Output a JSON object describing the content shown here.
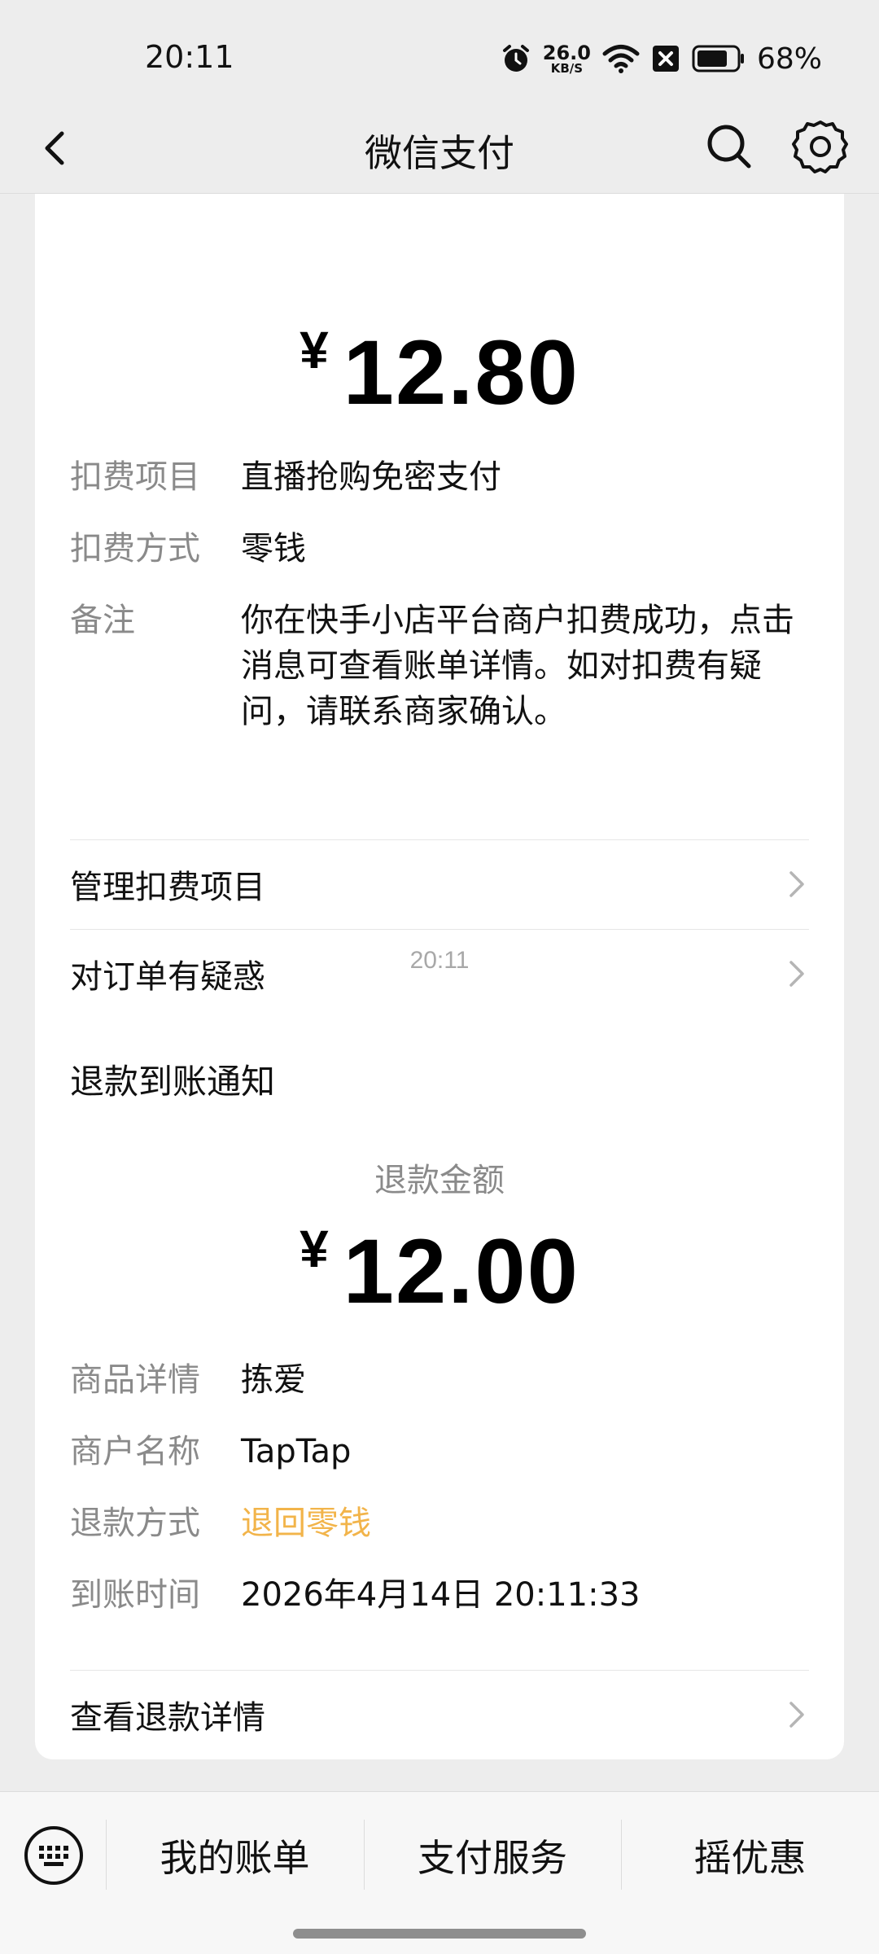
{
  "status_bar": {
    "time": "20:11",
    "net_speed_value": "26.0",
    "net_speed_unit": "KB/S",
    "battery_percent": "68%"
  },
  "nav": {
    "title": "微信支付"
  },
  "card1": {
    "amount_symbol": "¥",
    "amount_value": "12.80",
    "rows": [
      {
        "key": "扣费项目",
        "value": "直播抢购免密支付"
      },
      {
        "key": "扣费方式",
        "value": "零钱"
      },
      {
        "key": "备注",
        "value": "你在快手小店平台商户扣费成功，点击消息可查看账单详情。如对扣费有疑问，请联系商家确认。"
      }
    ],
    "links": [
      {
        "label": "管理扣费项目"
      },
      {
        "label": "对订单有疑惑"
      }
    ]
  },
  "timestamp": "20:11",
  "card2": {
    "title": "退款到账通知",
    "subtitle": "退款金额",
    "amount_symbol": "¥",
    "amount_value": "12.00",
    "rows": [
      {
        "key": "商品详情",
        "value": "拣爱"
      },
      {
        "key": "商户名称",
        "value": "TapTap"
      },
      {
        "key": "退款方式",
        "value": "退回零钱"
      },
      {
        "key": "到账时间",
        "value": "2026年4月14日 20:11:33"
      }
    ],
    "link": {
      "label": "查看退款详情"
    }
  },
  "bottom_menu": {
    "items": [
      "我的账单",
      "支付服务",
      "摇优惠"
    ]
  },
  "colors": {
    "accent_orange": "#f2b44a",
    "background": "#ededed",
    "card": "#ffffff"
  }
}
